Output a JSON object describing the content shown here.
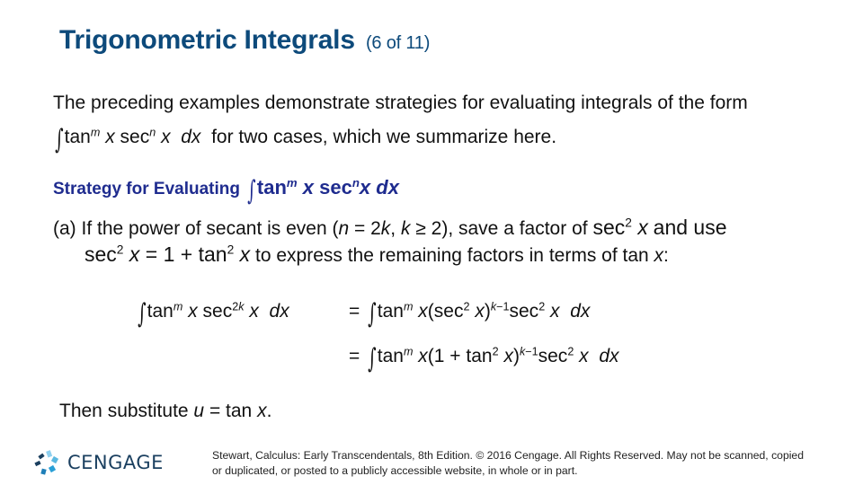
{
  "slide": {
    "title": "Trigonometric Integrals",
    "page_indicator": "(6 of 11)",
    "intro_line1": "The preceding examples demonstrate strategies for evaluating integrals of the form",
    "intro_line2_suffix": "for two cases, which we summarize here.",
    "strategy_label": "Strategy for Evaluating",
    "case_a_line1": "(a) If the power of secant is even (",
    "case_a_cond": "n = 2k, k ≥ 2",
    "case_a_line1_suffix": "), save a factor of",
    "case_a_and_use": "and use",
    "case_a_line2_suffix": "to express the remaining factors in terms of tan x:",
    "substitute": "Then substitute u = tan x."
  },
  "math": {
    "form": "∫ tanᵐ x secⁿ x dx",
    "save_factor": "sec² x",
    "identity": "sec² x = 1 + tan² x",
    "lhs": "∫ tanᵐ x sec²ᵏ x dx",
    "step1": "= ∫ tanᵐ x (sec² x)ᵏ⁻¹ sec² x dx",
    "step2": "= ∫ tanᵐ x (1 + tan² x)ᵏ⁻¹ sec² x dx"
  },
  "footer": {
    "logo_text": "CENGAGE",
    "copyright": "Stewart, Calculus: Early Transcendentals, 8th Edition. © 2016 Cengage. All Rights Reserved. May not be scanned, copied or duplicated, or posted to a publicly accessible website, in whole or in part."
  },
  "colors": {
    "title": "#0d4a7b",
    "strategy_heading": "#1f2c8f",
    "logo_dark": "#1a3f5f",
    "logo_light": "#5bb8e0"
  }
}
